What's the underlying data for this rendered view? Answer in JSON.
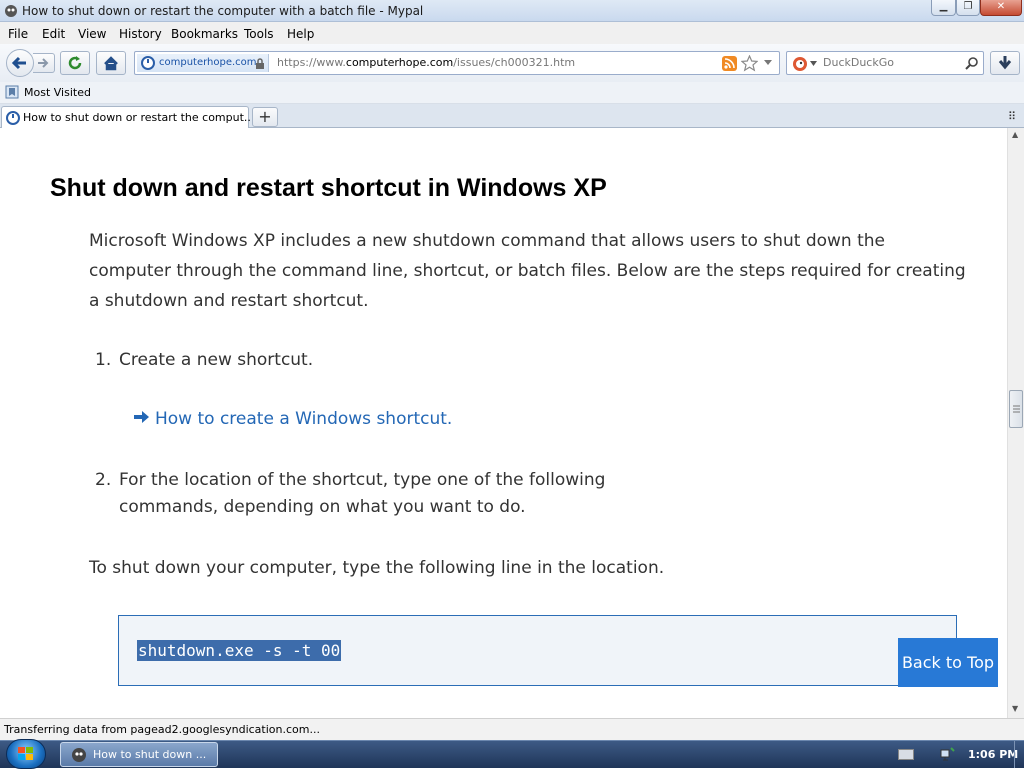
{
  "window": {
    "title": "How to shut down or restart the computer with a batch file - Mypal"
  },
  "menu": {
    "file": "File",
    "edit": "Edit",
    "view": "View",
    "history": "History",
    "bookmarks": "Bookmarks",
    "tools": "Tools",
    "help": "Help"
  },
  "urlbar": {
    "site_label": "computerhope.com",
    "url_prefix": "https://www.",
    "url_domain": "computerhope.com",
    "url_path": "/issues/ch000321.htm"
  },
  "search": {
    "placeholder": "DuckDuckGo"
  },
  "bookmarks": {
    "most_visited": "Most Visited"
  },
  "tabs": [
    {
      "label": "How to shut down or restart the comput..."
    }
  ],
  "content": {
    "heading": "Shut down and restart shortcut in Windows XP",
    "intro": "Microsoft Windows XP includes a new shutdown command that allows users to shut down the computer through the command line, shortcut, or batch files. Below are the steps required for creating a shutdown and restart shortcut.",
    "steps": [
      {
        "num": "1.",
        "text": "Create a new shortcut."
      },
      {
        "num": "2.",
        "line1": "For the location of the shortcut, type one of the following",
        "line2": "commands, depending on what you want to do."
      }
    ],
    "link": "How to create a Windows shortcut.",
    "shutdown_note": "To shut down your computer, type the following line in the location.",
    "code": "shutdown.exe -s -t 00",
    "back_to_top": "Back to Top"
  },
  "status": {
    "text": "Transferring data from pagead2.googlesyndication.com..."
  },
  "taskbar": {
    "task_label": "How to shut down ...",
    "clock": "1:06 PM"
  },
  "colors": {
    "link": "#2367b5",
    "back_to_top_bg": "#2879d6",
    "code_highlight": "#3d6cab",
    "code_border": "#2b6db6"
  }
}
